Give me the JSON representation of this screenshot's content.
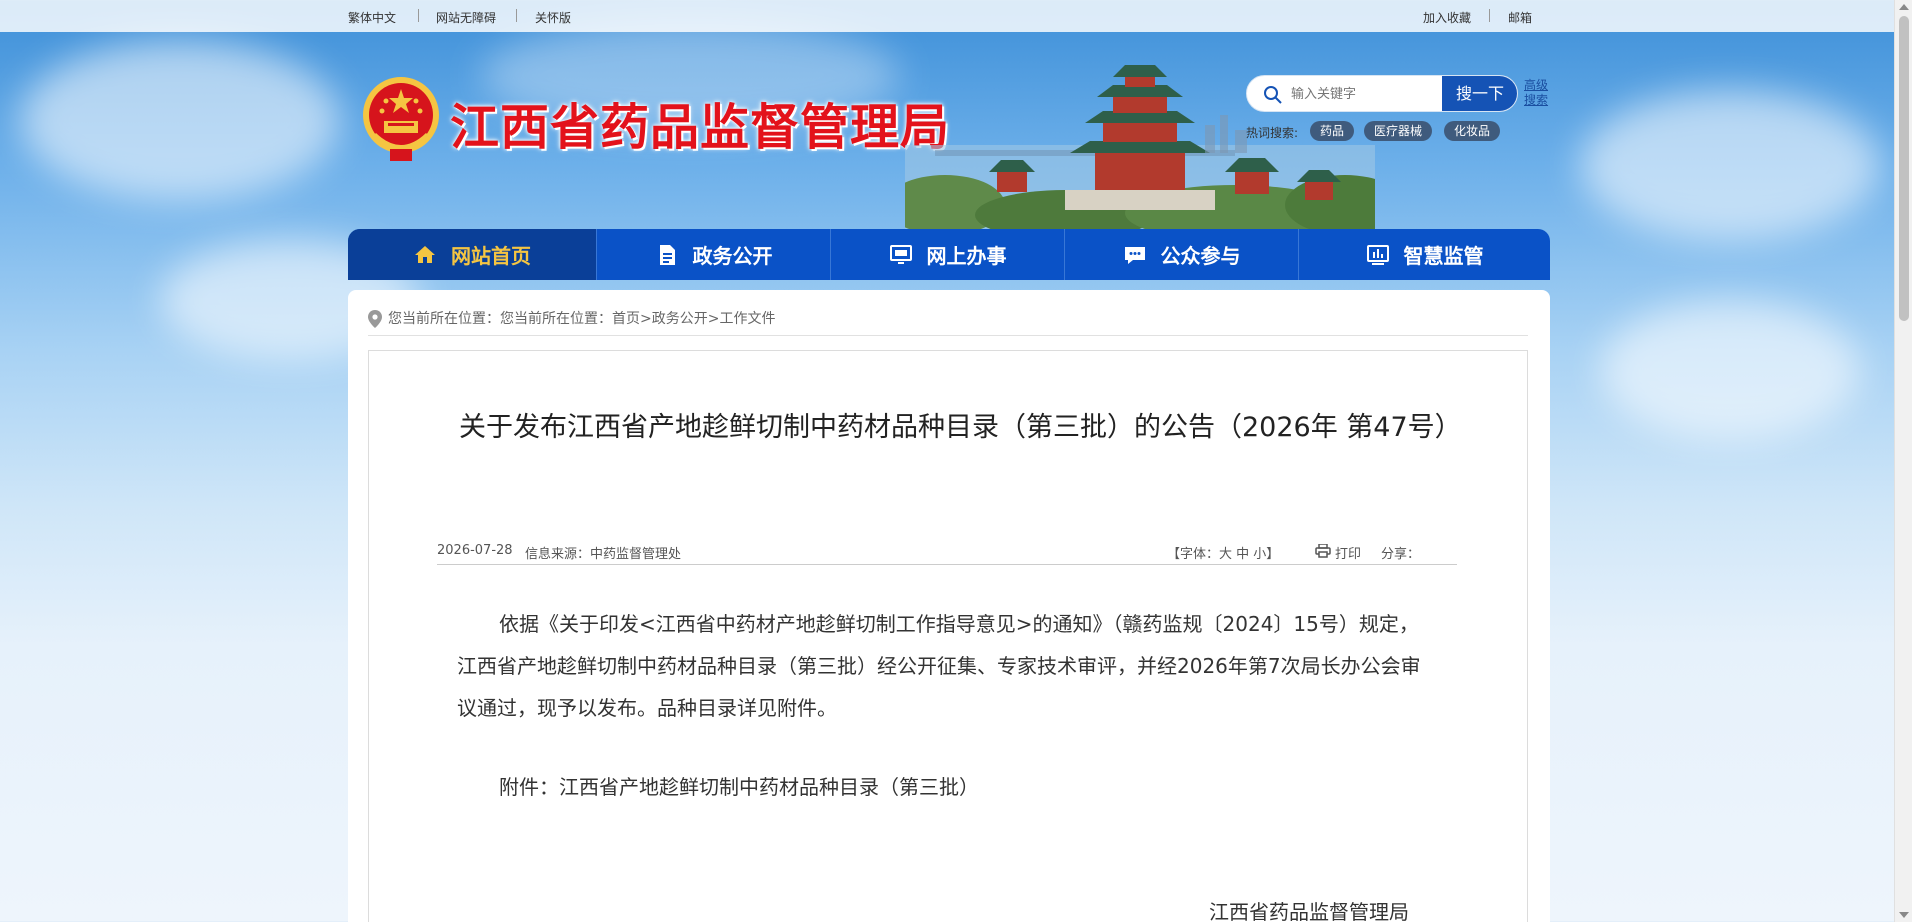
{
  "topbar": {
    "traditional": "繁体中文",
    "accessible": "网站无障碍",
    "care_mode": "关怀版",
    "bookmark": "加入收藏",
    "mail": "邮箱"
  },
  "header": {
    "site_title": "江西省药品监督管理局",
    "search_placeholder": "输入关键字",
    "search_button": "搜一下",
    "advanced_search": "高级搜索",
    "hot_label": "热词搜索:",
    "hot_tags": [
      "药品",
      "医疗器械",
      "化妆品"
    ]
  },
  "nav": {
    "items": [
      {
        "label": "网站首页",
        "icon": "home-icon"
      },
      {
        "label": "政务公开",
        "icon": "document-icon"
      },
      {
        "label": "网上办事",
        "icon": "monitor-icon"
      },
      {
        "label": "公众参与",
        "icon": "chat-icon"
      },
      {
        "label": "智慧监管",
        "icon": "chart-icon"
      }
    ]
  },
  "breadcrumb": {
    "text": "您当前所在位置：您当前所在位置：首页>政务公开>工作文件"
  },
  "article": {
    "title": "关于发布江西省产地趁鲜切制中药材品种目录（第三批）的公告（2026年 第47号）",
    "date": "2026-07-28",
    "source": "信息来源：中药监督管理处",
    "font_control": "【字体：大  中  小】",
    "print": "打印",
    "share": "分享：",
    "paragraph": "依据《关于印发<江西省中药材产地趁鲜切制工作指导意见>的通知》（赣药监规〔2024〕15号）规定，江西省产地趁鲜切制中药材品种目录（第三批）经公开征集、专家技术审评，并经2026年第7次局长办公会审议通过，现予以发布。品种目录详见附件。",
    "attachment": "附件：江西省产地趁鲜切制中药材品种目录（第三批）",
    "signature": "江西省药品监督管理局"
  },
  "colors": {
    "nav_bg": "#0a52c7",
    "nav_active_bg": "#0a3f98",
    "nav_active_text": "#f5c542",
    "title_red": "#e3121b"
  }
}
